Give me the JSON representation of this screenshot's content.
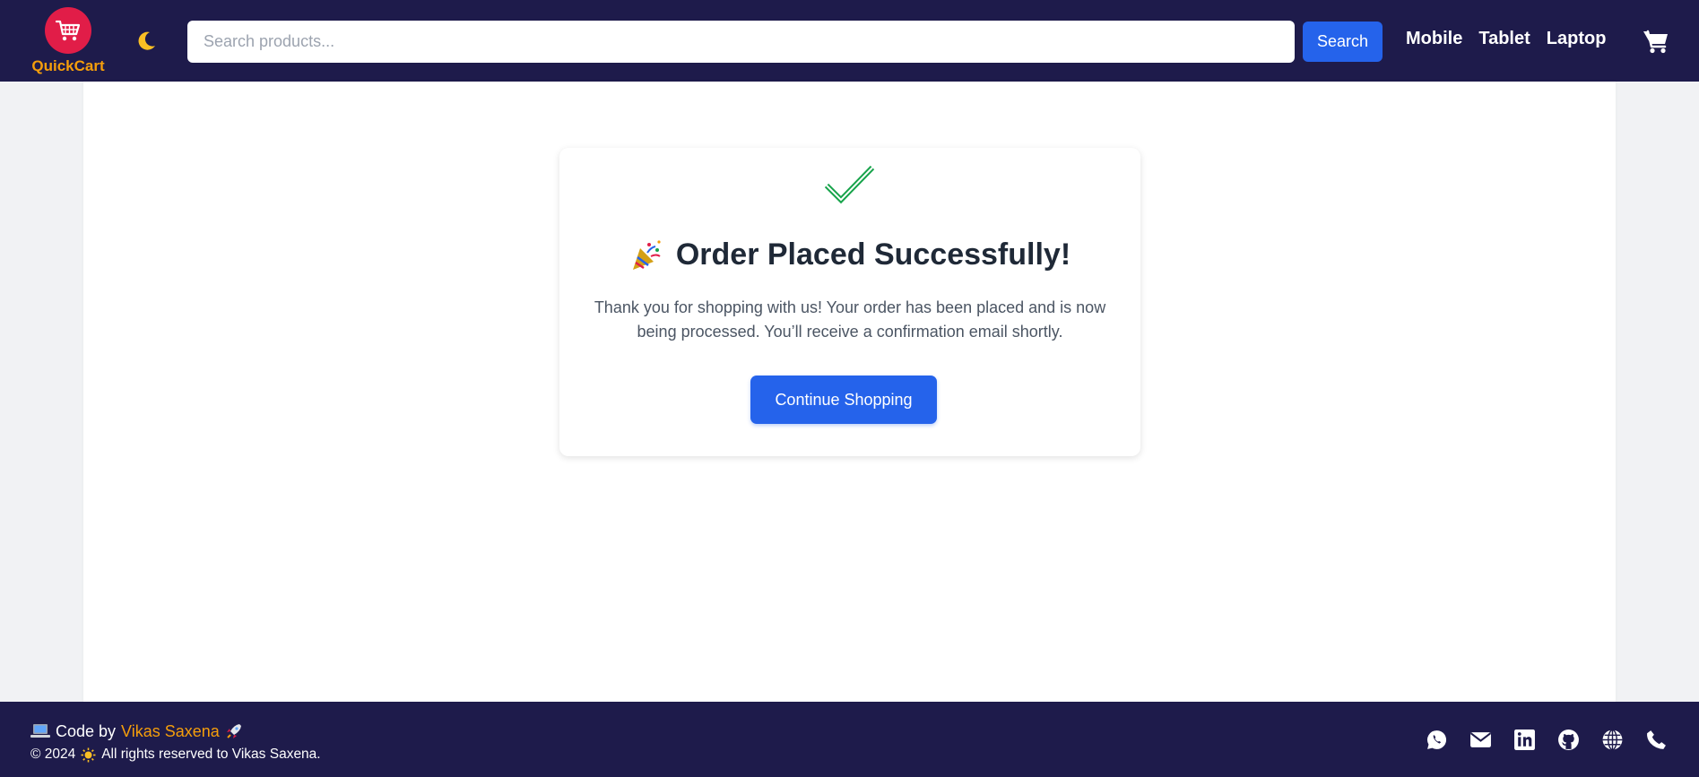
{
  "header": {
    "brand": "QuickCart",
    "search_placeholder": "Search products...",
    "search_label": "Search",
    "nav": [
      "Mobile",
      "Tablet",
      "Laptop"
    ]
  },
  "main": {
    "title": "Order Placed Successfully!",
    "message": "Thank you for shopping with us! Your order has been placed and is now being processed. You’ll receive a confirmation email shortly.",
    "button_label": "Continue Shopping"
  },
  "footer": {
    "code_by": "Code by",
    "author": "Vikas Saxena",
    "year": "© 2024",
    "rights": "All rights reserved to Vikas Saxena.",
    "socials": [
      "whatsapp-icon",
      "email-icon",
      "linkedin-icon",
      "github-icon",
      "globe-icon",
      "phone-icon"
    ]
  },
  "colors": {
    "header_bg": "#1e1b4b",
    "accent": "#2563eb",
    "brand": "#f59e0b",
    "logo_circle": "#e11d48",
    "success": "#16a34a"
  }
}
